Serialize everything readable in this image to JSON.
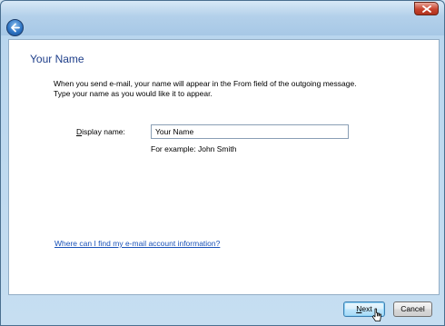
{
  "window": {
    "close_icon": "close-icon",
    "back_icon": "back-arrow-icon"
  },
  "page": {
    "heading": "Your Name",
    "description_lines": [
      "When you send e-mail, your name will appear in the From field of the outgoing message.",
      "Type your name as you would like it to appear."
    ]
  },
  "form": {
    "display_name_label_first": "D",
    "display_name_label_rest": "isplay name:",
    "display_name_value": "Your Name",
    "example_text": "For example: John Smith"
  },
  "links": {
    "help": "Where can I find my e-mail account information?"
  },
  "buttons": {
    "next_first": "N",
    "next_rest": "ext",
    "cancel": "Cancel"
  },
  "colors": {
    "heading": "#1f3f8a",
    "link": "#1a52b8",
    "close_button": "#c8432e"
  }
}
